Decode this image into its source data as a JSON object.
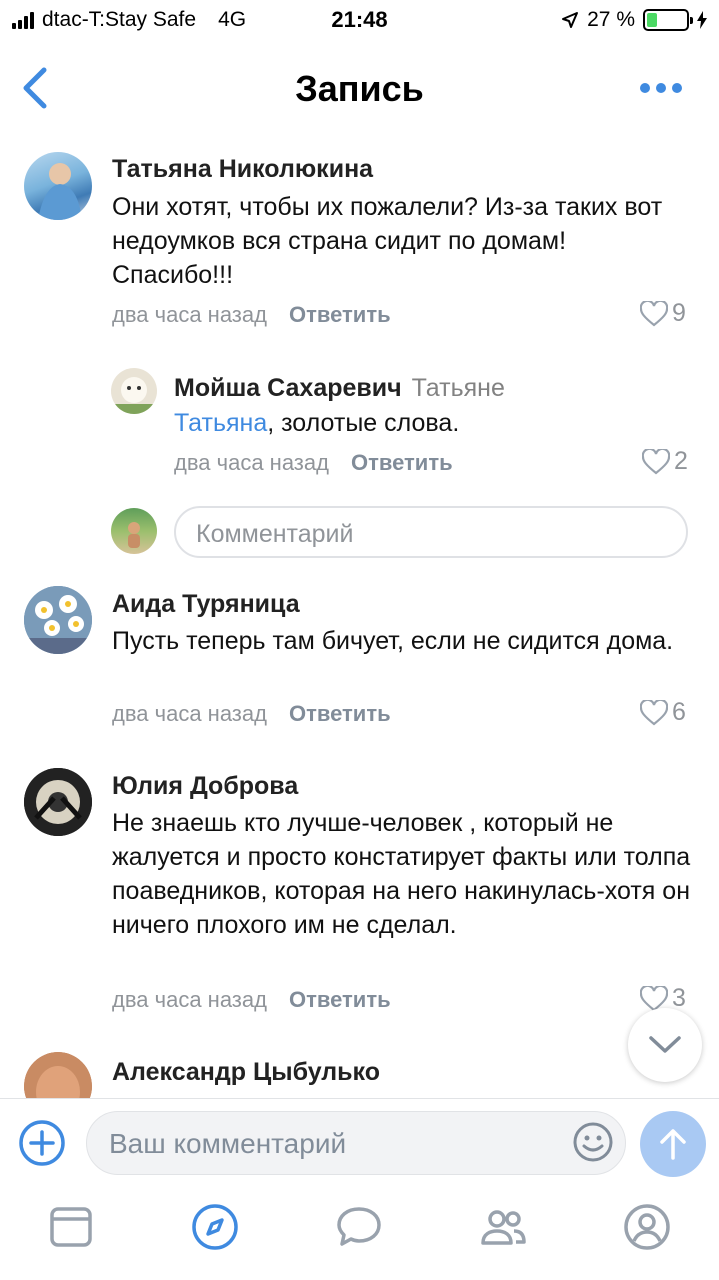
{
  "status_bar": {
    "carrier": "dtac-T:Stay Safe",
    "network": "4G",
    "time": "21:48",
    "battery": "27 %",
    "battery_level": 0.27,
    "battery_color": "#4cd964"
  },
  "nav": {
    "title": "Запись",
    "back_icon": "chevron-left-icon",
    "more_icon": "more-dots-icon",
    "accent": "#3f8ae0"
  },
  "comments": [
    {
      "author": "Татьяна Николюкина",
      "text": "Они хотят, чтобы их пожалели? Из-за таких вот недоумков вся страна сидит по домам! Спасибо!!!",
      "time": "два часа назад",
      "reply_label": "Ответить",
      "likes": "9"
    },
    {
      "author": "Мойша Сахаревич",
      "to": "Татьяне",
      "mention": "Татьяна",
      "text": ", золотые слова.",
      "time": "два часа назад",
      "reply_label": "Ответить",
      "likes": "2"
    },
    {
      "author": "Аида Туряница",
      "text": "Пусть теперь там бичует, если не сидится дома.",
      "time": "два часа назад",
      "reply_label": "Ответить",
      "likes": "6"
    },
    {
      "author": "Юлия Доброва",
      "text": "Не знаешь кто лучше-человек , который не жалуется и просто констатирует факты или толпа поаведников, которая на него накинулась-хотя он ничего плохого им не сделал.",
      "time": "два часа назад",
      "reply_label": "Ответить",
      "likes": "3"
    },
    {
      "author": "Александр Цыбулько"
    }
  ],
  "reply_input": {
    "placeholder": "Комментарий"
  },
  "composer": {
    "placeholder": "Ваш комментарий",
    "add_icon": "plus-circle-icon",
    "emoji_icon": "smile-icon",
    "send_icon": "arrow-up-icon"
  },
  "tabbar": {
    "items": [
      "news-icon",
      "compass-icon",
      "messages-icon",
      "friends-icon",
      "profile-icon"
    ],
    "active": "compass-icon"
  }
}
